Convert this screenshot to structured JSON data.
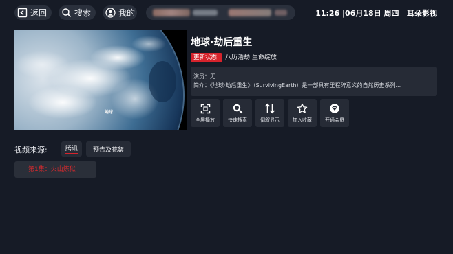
{
  "topbar": {
    "back_label": "返回",
    "search_label": "搜索",
    "mine_label": "我的",
    "clock": "11:26 |06月18日 周四",
    "app_name": "耳朵影视",
    "icons": {
      "back": "back-arrow-icon",
      "search": "search-icon",
      "mine": "user-icon"
    }
  },
  "detail": {
    "title": "地球·劫后重生",
    "status_label": "更新状态:",
    "status_value": "八历浩劫 生命绽放",
    "actors_label": "演员：",
    "actors_value": "无",
    "intro_label": "简介：",
    "intro_value": "《地球·劫后重生》（SurvivingEarth）是一部具有里程碑意义的自然历史系列...",
    "poster_logo": "地球"
  },
  "actions": [
    {
      "label": "全屏播放",
      "icon": "fullscreen-icon"
    },
    {
      "label": "快速搜索",
      "icon": "search-icon"
    },
    {
      "label": "倒叙显示",
      "icon": "sort-icon"
    },
    {
      "label": "加入收藏",
      "icon": "star-icon"
    },
    {
      "label": "开通会员",
      "icon": "vip-icon"
    }
  ],
  "source": {
    "label": "视频来源:",
    "tabs": [
      {
        "label": "腾讯",
        "active": true
      },
      {
        "label": "预告及花絮",
        "active": false
      }
    ]
  },
  "episodes": [
    {
      "label": "第1集：火山炼狱"
    }
  ],
  "colors": {
    "accent": "#d6232c",
    "background": "#161b26",
    "panel": "#262b36"
  }
}
